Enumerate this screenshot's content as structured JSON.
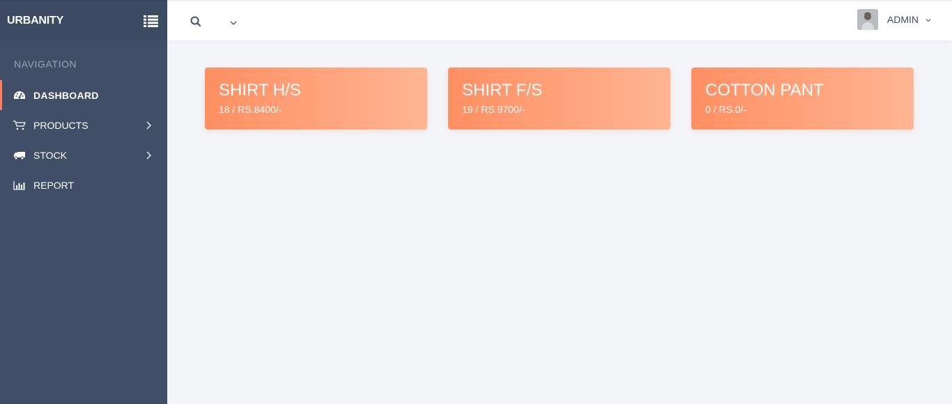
{
  "sidebar": {
    "brand": "URBANITY",
    "toggle_icon": "list-icon",
    "nav_heading": "NAVIGATION",
    "items": [
      {
        "label": "DASHBOARD",
        "icon": "dashboard-icon",
        "active": true
      },
      {
        "label": "PRODUCTS",
        "icon": "cart-icon",
        "has_submenu": true
      },
      {
        "label": "STOCK",
        "icon": "truck-icon",
        "has_submenu": true
      },
      {
        "label": "REPORT",
        "icon": "bar-chart-icon"
      }
    ]
  },
  "topbar": {
    "user_name": "ADMIN"
  },
  "cards": [
    {
      "title": "SHIRT H/S",
      "subtitle": "18 / RS.8400/-"
    },
    {
      "title": "SHIRT F/S",
      "subtitle": "19 / RS.9700/-"
    },
    {
      "title": "COTTON PANT",
      "subtitle": "0 / RS.0/-"
    }
  ],
  "colors": {
    "sidebar_bg": "#404e67",
    "accent": "#ff7f5d",
    "card_gradient_start": "#ff8f63",
    "card_gradient_end": "#ffb592",
    "page_bg": "#f4f5f9"
  }
}
